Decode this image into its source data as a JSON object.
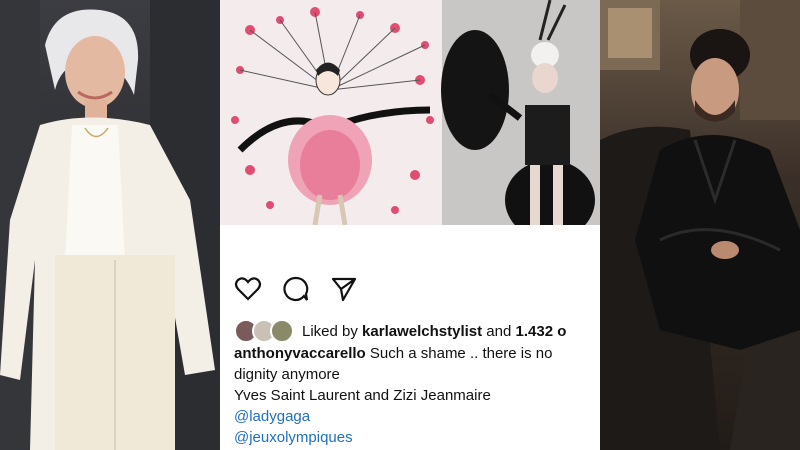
{
  "post": {
    "likes_prefix": "Liked by",
    "liked_by_user": "karlawelchstylist",
    "likes_and": "and",
    "likes_count": "1.432 o",
    "caption_user": "anthonyvaccarello",
    "caption_text_line1": "Such a shame .. there is no",
    "caption_text_line2": "dignity anymore",
    "caption_line3": "Yves Saint Laurent and Zizi Jeanmaire",
    "mention_1": "@ladygaga",
    "mention_2": "@jeuxolympiques"
  },
  "icons": [
    "heart-icon",
    "comment-icon",
    "share-icon"
  ],
  "colors": {
    "mention": "#1f6fc2",
    "text": "#111111"
  }
}
